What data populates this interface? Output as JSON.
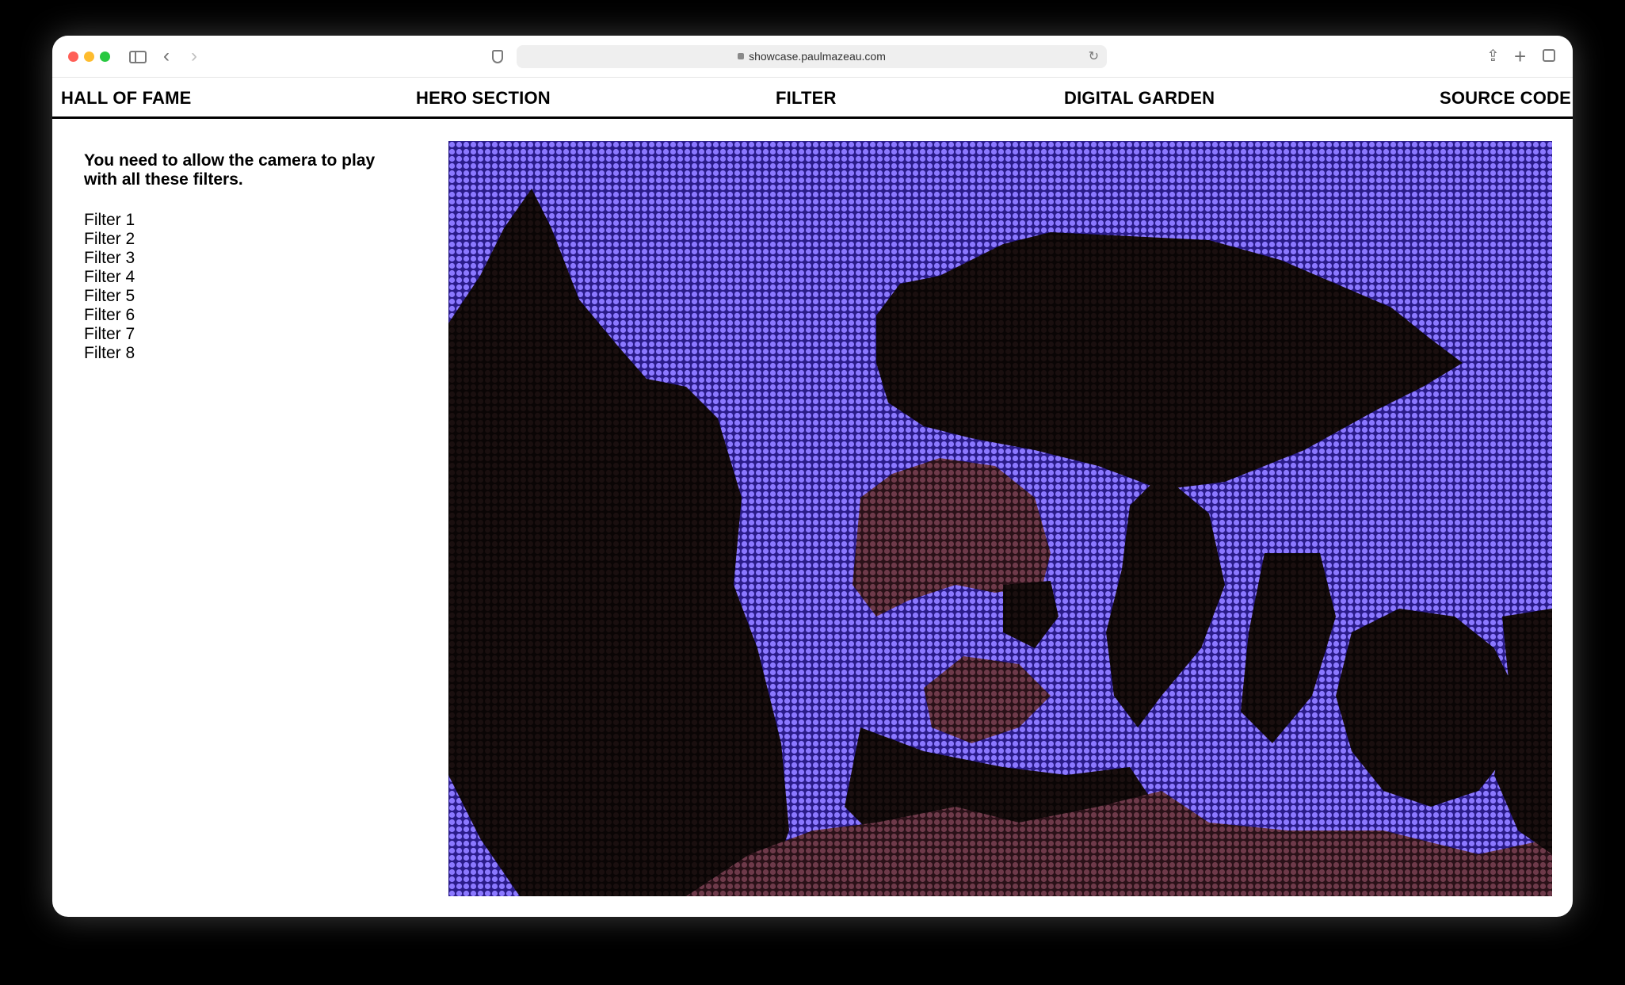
{
  "browser": {
    "url": "showcase.paulmazeau.com"
  },
  "nav": {
    "items": [
      "HALL OF FAME",
      "HERO SECTION",
      "FILTER",
      "DIGITAL GARDEN",
      "SOURCE CODE"
    ]
  },
  "sidebar": {
    "notice": "You need to allow the camera to play with all these filters.",
    "filters": [
      "Filter 1",
      "Filter 2",
      "Filter 3",
      "Filter 4",
      "Filter 5",
      "Filter 6",
      "Filter 7",
      "Filter 8"
    ]
  },
  "colors": {
    "dot_light": "#8b78ff",
    "dot_dark": "#1a0f0f",
    "dot_mid": "#6e3a4a"
  }
}
